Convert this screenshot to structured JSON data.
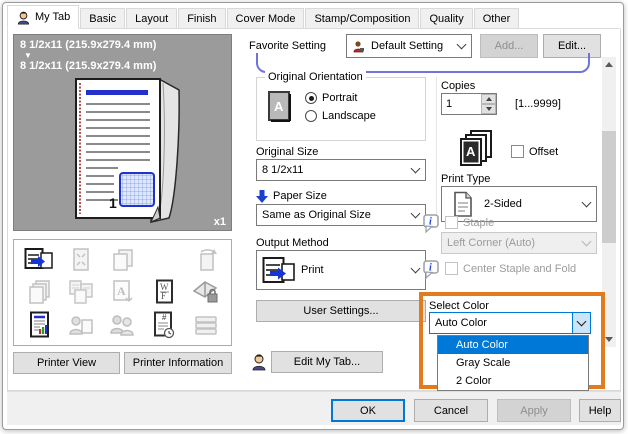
{
  "tabs": [
    {
      "label": "My Tab",
      "active": true
    },
    {
      "label": "Basic",
      "active": false
    },
    {
      "label": "Layout",
      "active": false
    },
    {
      "label": "Finish",
      "active": false
    },
    {
      "label": "Cover Mode",
      "active": false
    },
    {
      "label": "Stamp/Composition",
      "active": false
    },
    {
      "label": "Quality",
      "active": false
    },
    {
      "label": "Other",
      "active": false
    }
  ],
  "preview": {
    "original_size_line": "8 1/2x11 (215.9x279.4 mm)",
    "paper_size_line": "8 1/2x11 (215.9x279.4 mm)",
    "zoom_badge": "x1",
    "page_number": "1"
  },
  "feature_icons": [
    "printer-output-icon",
    "fit-page-icon",
    "copy-pages-icon",
    "rotate-page-icon",
    "stacked-pages-icon",
    "combine-pages-icon",
    "font-substitution-icon",
    "watermark-icon",
    "booklet-security-icon",
    "color-document-icon",
    "user-page-icon",
    "account-track-icon",
    "page-number-date-icon",
    "paper-stack-icon"
  ],
  "left_panel": {
    "printer_view": "Printer View",
    "printer_information": "Printer Information"
  },
  "favorite": {
    "label": "Favorite Setting",
    "value": "Default Setting",
    "add": "Add...",
    "edit": "Edit..."
  },
  "left_column": {
    "original_orientation": {
      "label": "Original Orientation",
      "portrait": "Portrait",
      "landscape": "Landscape",
      "selected": "Portrait"
    },
    "original_size": {
      "label": "Original Size",
      "value": "8 1/2x11"
    },
    "paper_size": {
      "label": "Paper Size",
      "value": "Same as Original Size"
    },
    "output_method": {
      "label": "Output Method",
      "value": "Print"
    },
    "user_settings": "User Settings...",
    "edit_my_tab": "Edit My Tab..."
  },
  "right_column": {
    "copies": {
      "label": "Copies",
      "value": "1",
      "range": "[1...9999]"
    },
    "offset": {
      "label": "Offset",
      "checked": false
    },
    "print_type": {
      "label": "Print Type",
      "value": "2-Sided"
    },
    "staple": {
      "label": "Staple",
      "value": "Left Corner (Auto)",
      "enabled": false,
      "checked": false
    },
    "center_staple": {
      "label": "Center Staple and Fold",
      "enabled": false,
      "checked": false
    },
    "select_color": {
      "label": "Select Color",
      "value": "Auto Color",
      "options": [
        "Auto Color",
        "Gray Scale",
        "2 Color"
      ],
      "highlighted": "Auto Color"
    }
  },
  "footer": {
    "ok": "OK",
    "cancel": "Cancel",
    "apply": "Apply",
    "help": "Help"
  },
  "colors": {
    "selection_blue": "#0078d7",
    "highlight_orange": "#e07c1e",
    "accent_blue_box": "#6f74d8",
    "preview_background": "#9b9b9b",
    "paper_size_arrow_blue": "#1d3fd0"
  }
}
